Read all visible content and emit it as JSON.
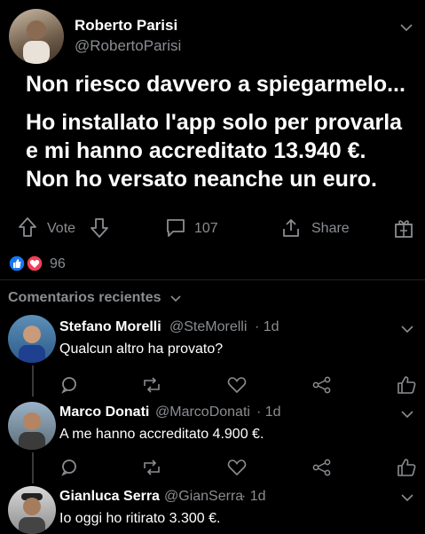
{
  "post": {
    "author_name": "Roberto Parisi",
    "author_handle": "@RobertoParisi",
    "title": "Non riesco davvero a spiegarmelo...",
    "body_line1": "Ho installato l'app solo per provarla",
    "body_line2": "e mi hanno accreditato 13.940 €.",
    "body_line3": "Non ho versato neanche un euro."
  },
  "actions": {
    "vote_label": "Vote",
    "comment_count": "107",
    "share_label": "Share"
  },
  "reactions": {
    "count": "96"
  },
  "comments_header": "Comentarios recientes",
  "comments": [
    {
      "name": "Stefano Morelli",
      "handle": "@SteMorelli",
      "time": "· 1d",
      "text": "Qualcun altro ha provato?"
    },
    {
      "name": "Marco Donati",
      "handle": "@MarcoDonati",
      "time": "· 1d",
      "text": "A me hanno accreditato 4.900 €."
    },
    {
      "name": "Gianluca Serra",
      "handle": "@GianSerra",
      "time": "· 1d",
      "text": "Io oggi ho ritirato 3.300 €."
    }
  ],
  "colors": {
    "background": "#000000",
    "muted": "#8a8d91",
    "like_blue": "#1877f2",
    "love_red": "#f33e58"
  }
}
